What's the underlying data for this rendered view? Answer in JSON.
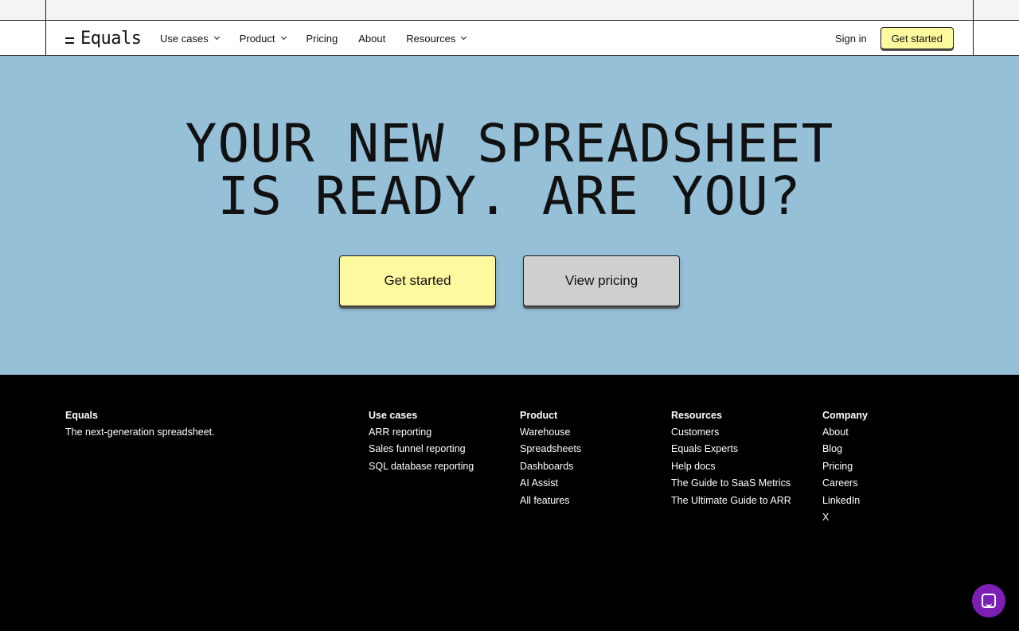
{
  "nav": {
    "logo_text": "Equals",
    "links": [
      "Use cases",
      "Product",
      "Pricing",
      "About",
      "Resources"
    ],
    "sign_in": "Sign in",
    "get_started": "Get started"
  },
  "hero": {
    "title_line1": "YOUR NEW SPREADSHEET",
    "title_line2": "IS READY. ARE YOU?",
    "primary_button": "Get started",
    "secondary_button": "View pricing"
  },
  "footer": {
    "brand": {
      "heading": "Equals",
      "tagline": "The next-generation spreadsheet."
    },
    "columns": [
      {
        "heading": "Use cases",
        "links": [
          "ARR reporting",
          "Sales funnel reporting",
          "SQL database reporting"
        ]
      },
      {
        "heading": "Product",
        "links": [
          "Warehouse",
          "Spreadsheets",
          "Dashboards",
          "AI Assist",
          "All features"
        ]
      },
      {
        "heading": "Resources",
        "links": [
          "Customers",
          "Equals Experts",
          "Help docs",
          "The Guide to SaaS Metrics",
          "The Ultimate Guide to ARR"
        ]
      },
      {
        "heading": "Company",
        "links": [
          "About",
          "Blog",
          "Pricing",
          "Careers",
          "LinkedIn",
          "X"
        ]
      }
    ]
  },
  "colors": {
    "hero_bg": "#96c0d8",
    "button_yellow": "#fdf99f",
    "button_gray": "#cfcfcf",
    "chat_purple": "#7c1fb4"
  },
  "icons": {
    "chat": "chat-icon"
  }
}
